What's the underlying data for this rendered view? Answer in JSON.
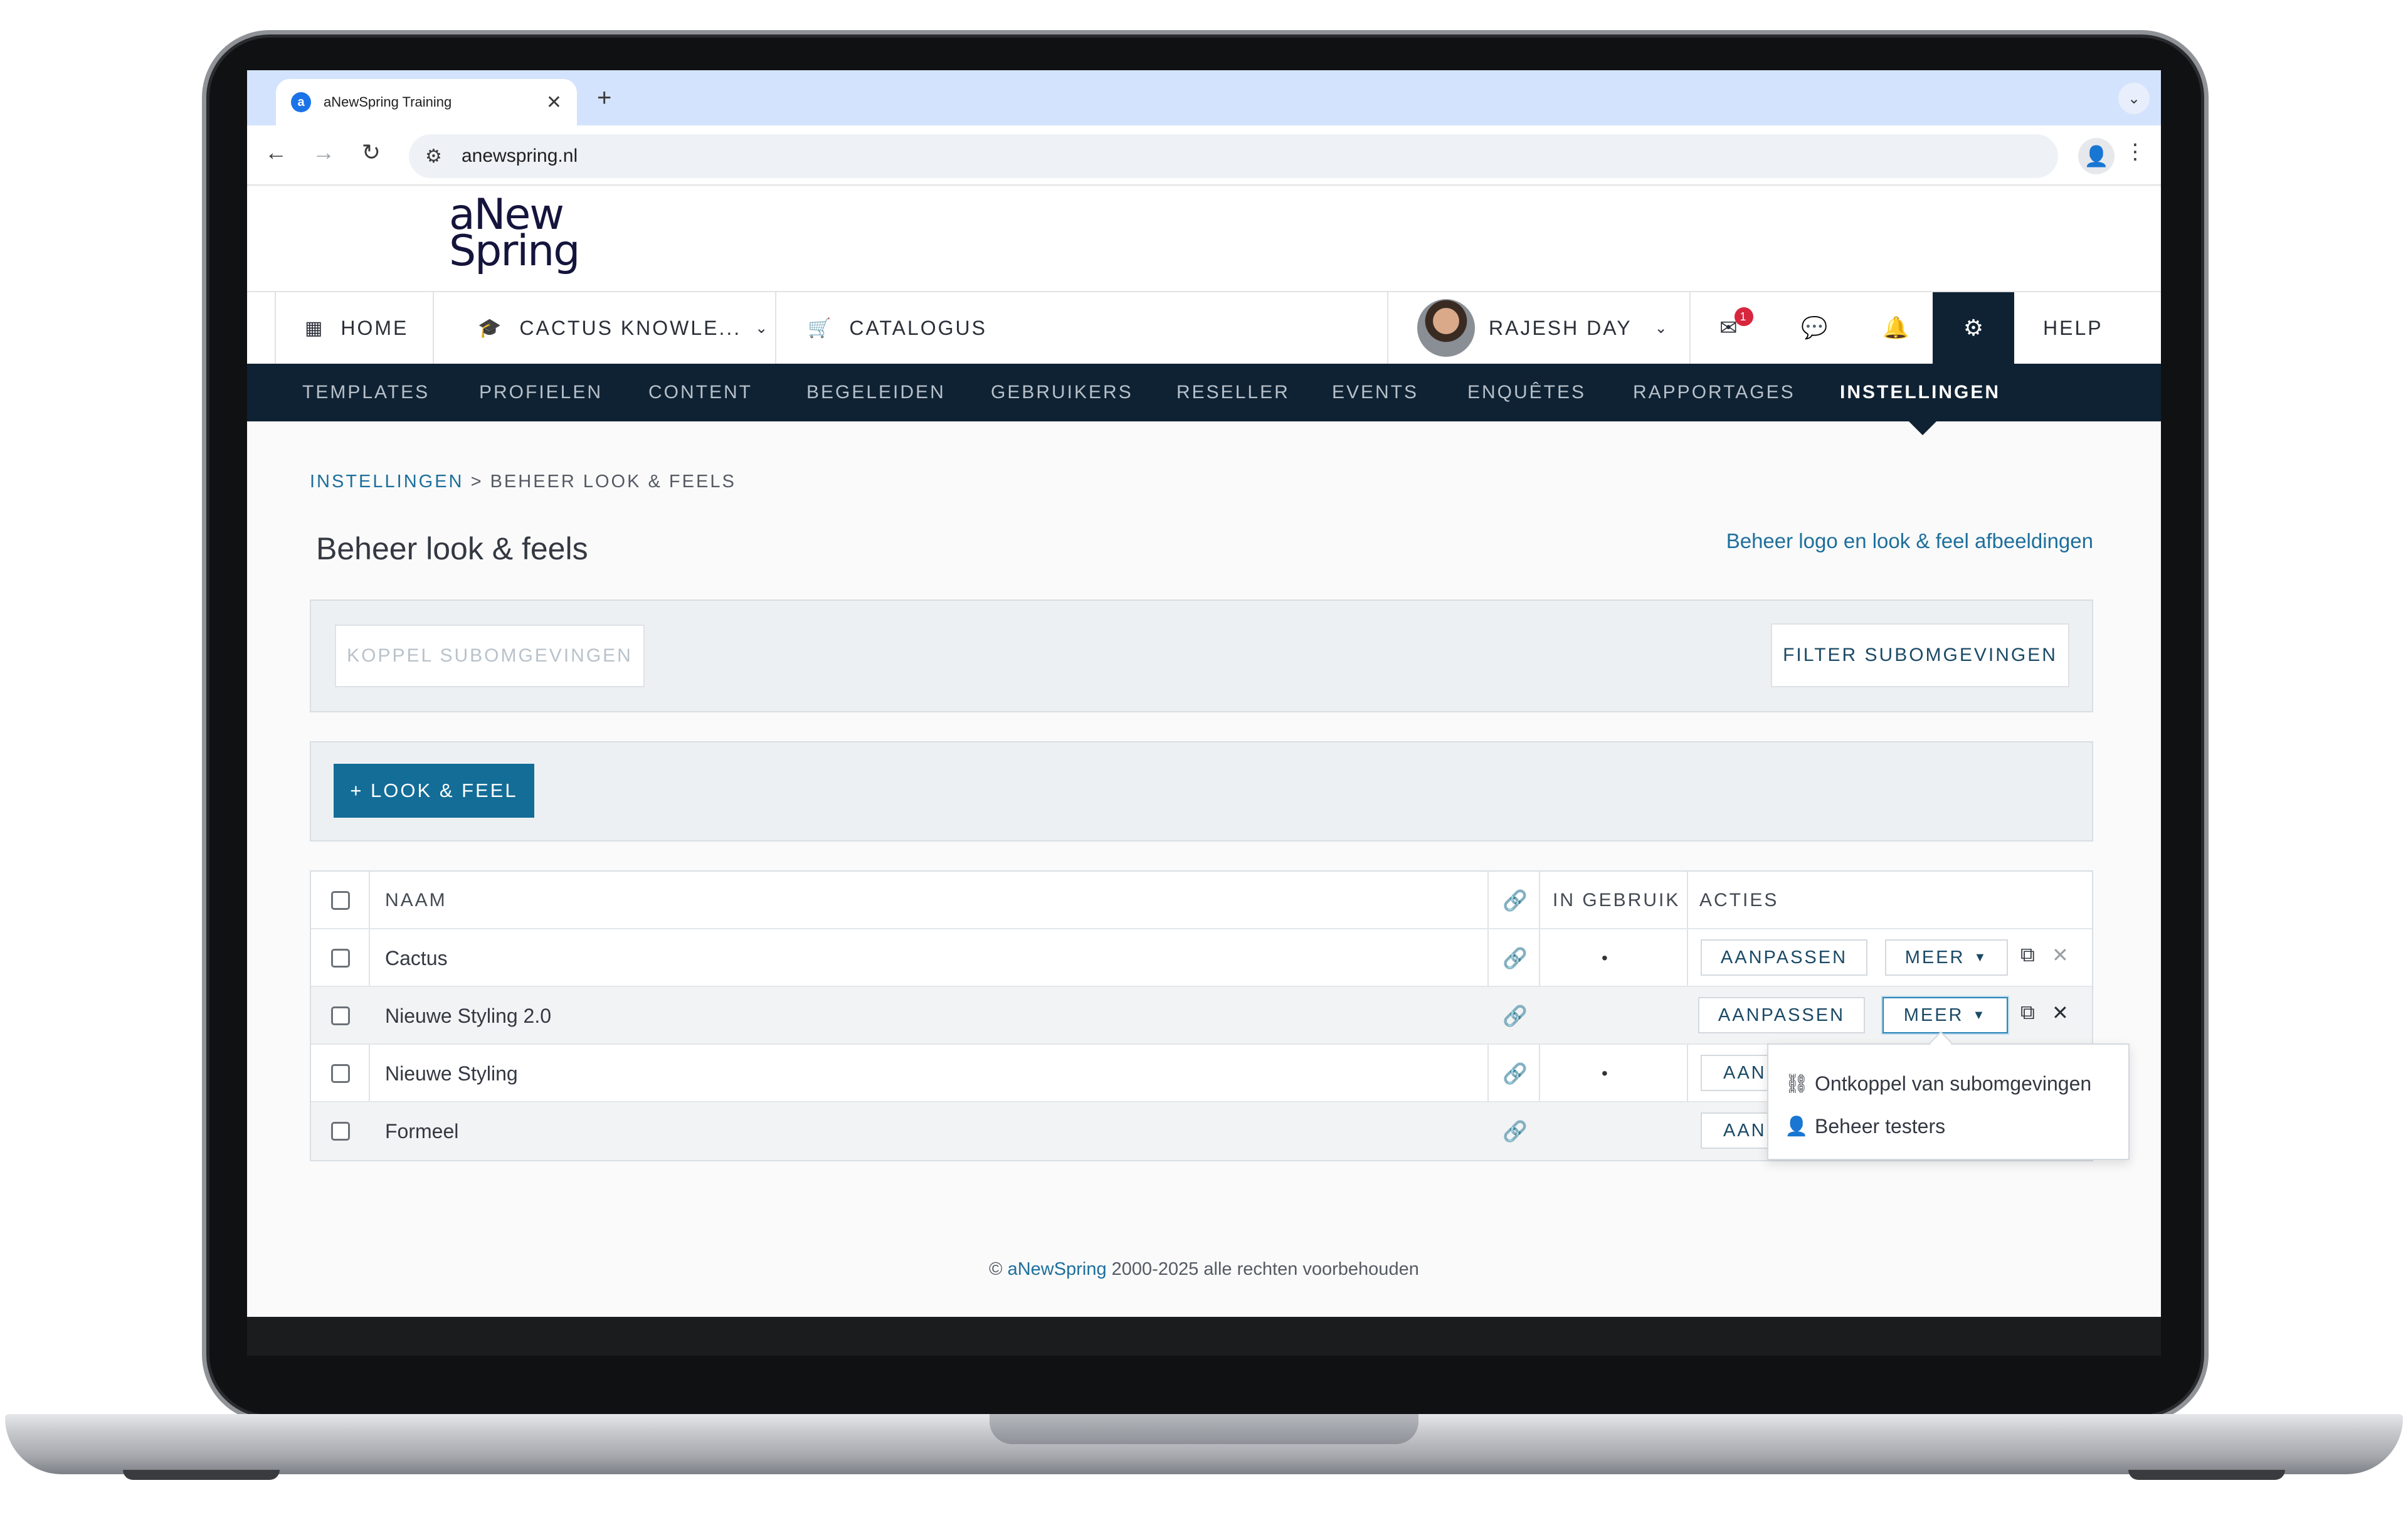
{
  "browser": {
    "tab_title": "aNewSpring Training",
    "favicon_letter": "a",
    "url": "anewspring.nl"
  },
  "site": {
    "logo_line1": "aNew",
    "logo_line2": "Spring"
  },
  "mainnav": {
    "home": "HOME",
    "environment": "CACTUS KNOWLE...",
    "catalogue": "CATALOGUS",
    "user": "RAJESH DAY",
    "messages_badge": "1",
    "help": "HELP"
  },
  "subnav": [
    "TEMPLATES",
    "PROFIELEN",
    "CONTENT",
    "BEGELEIDEN",
    "GEBRUIKERS",
    "RESELLER",
    "EVENTS",
    "ENQUÊTES",
    "RAPPORTAGES",
    "INSTELLINGEN"
  ],
  "breadcrumb": {
    "parent": "INSTELLINGEN",
    "separator": ">",
    "current": "BEHEER LOOK & FEELS"
  },
  "page": {
    "title": "Beheer look & feels",
    "right_link": "Beheer logo en look & feel afbeeldingen"
  },
  "toolbar": {
    "link_sub": "KOPPEL SUBOMGEVINGEN",
    "filter_sub": "FILTER SUBOMGEVINGEN",
    "add_label": "+ LOOK & FEEL"
  },
  "table": {
    "headers": {
      "name": "NAAM",
      "in_use": "IN GEBRUIK",
      "actions": "ACTIES"
    },
    "rows": [
      {
        "name": "Cactus",
        "in_use": "•",
        "edit": "AANPASSEN",
        "more": "MEER"
      },
      {
        "name": "Nieuwe Styling 2.0",
        "in_use": "",
        "edit": "AANPASSEN",
        "more": "MEER"
      },
      {
        "name": "Nieuwe Styling",
        "in_use": "•",
        "edit": "AAN"
      },
      {
        "name": "Formeel",
        "in_use": "",
        "edit": "AAN"
      }
    ]
  },
  "dropdown": {
    "items": [
      "Ontkoppel van subomgevingen",
      "Beheer testers"
    ]
  },
  "footer": {
    "prefix": "©",
    "brand": "aNewSpring",
    "suffix": "2000-2025 alle rechten voorbehouden"
  },
  "colors": {
    "primary": "#136d97",
    "navy": "#0f2233",
    "link": "#1e6f9c",
    "badge": "#d7263d"
  }
}
